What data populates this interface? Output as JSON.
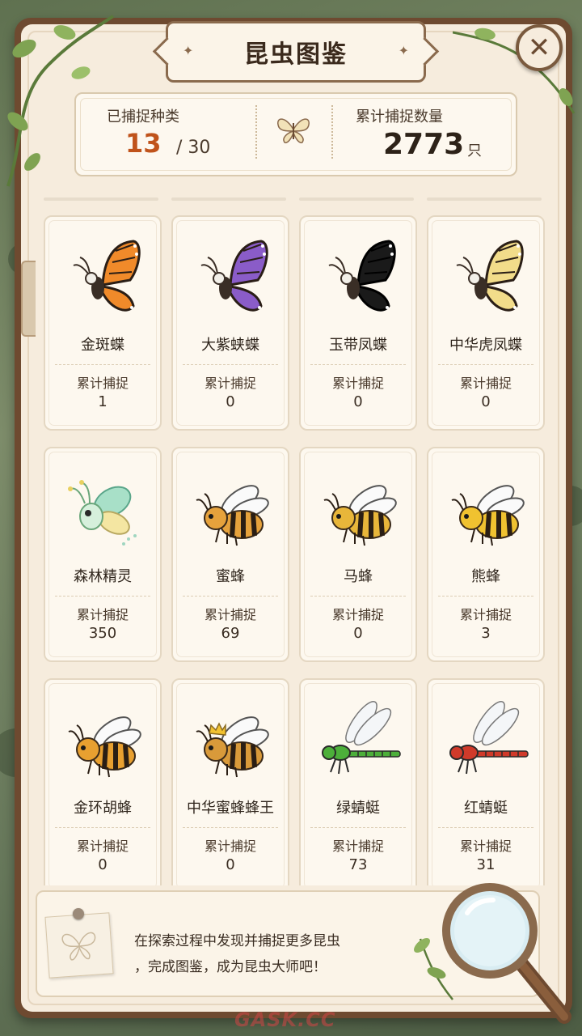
{
  "title": "昆虫图鉴",
  "stats": {
    "species_label": "已捕捉种类",
    "species_caught": "13",
    "species_total": "/ 30",
    "catch_label": "累计捕捉数量",
    "catch_total": "2773",
    "catch_unit": "只"
  },
  "insects": [
    {
      "name": "金斑蝶",
      "label": "累计捕捉",
      "count": "1",
      "icon": "monarch-butterfly-icon",
      "color": "#f08a2a"
    },
    {
      "name": "大紫蛱蝶",
      "label": "累计捕捉",
      "count": "0",
      "icon": "purple-emperor-butterfly-icon",
      "color": "#8a5cc8"
    },
    {
      "name": "玉带凤蝶",
      "label": "累计捕捉",
      "count": "0",
      "icon": "black-swallowtail-icon",
      "color": "#1a1a1a"
    },
    {
      "name": "中华虎凤蝶",
      "label": "累计捕捉",
      "count": "0",
      "icon": "tiger-swallowtail-icon",
      "color": "#f2dc8a"
    },
    {
      "name": "森林精灵",
      "label": "累计捕捉",
      "count": "350",
      "icon": "forest-sprite-icon",
      "color": "#a8e0c8"
    },
    {
      "name": "蜜蜂",
      "label": "累计捕捉",
      "count": "69",
      "icon": "honeybee-icon",
      "color": "#e6a23c"
    },
    {
      "name": "马蜂",
      "label": "累计捕捉",
      "count": "0",
      "icon": "wasp-icon",
      "color": "#e8b63a"
    },
    {
      "name": "熊蜂",
      "label": "累计捕捉",
      "count": "3",
      "icon": "bumblebee-icon",
      "color": "#f0c230"
    },
    {
      "name": "金环胡蜂",
      "label": "累计捕捉",
      "count": "0",
      "icon": "hornet-icon",
      "color": "#e8a030"
    },
    {
      "name": "中华蜜蜂蜂王",
      "label": "累计捕捉",
      "count": "0",
      "icon": "queen-bee-icon",
      "color": "#d99a3a"
    },
    {
      "name": "绿蜻蜓",
      "label": "累计捕捉",
      "count": "73",
      "icon": "green-dragonfly-icon",
      "color": "#4caf3a"
    },
    {
      "name": "红蜻蜓",
      "label": "累计捕捉",
      "count": "31",
      "icon": "red-dragonfly-icon",
      "color": "#d03a2a"
    }
  ],
  "tip": {
    "line1": "在探索过程中发现并捕捉更多昆虫",
    "line2": "，完成图鉴，成为昆虫大师吧！"
  },
  "watermark": "GASK.CC"
}
